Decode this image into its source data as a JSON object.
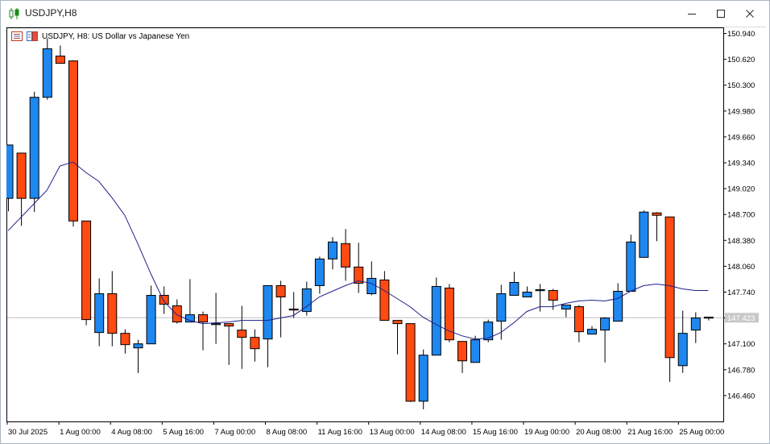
{
  "window": {
    "title": "USDJPY,H8",
    "icon": "candlestick-chart-icon",
    "controls": [
      "minimize-icon",
      "maximize-icon",
      "close-icon"
    ]
  },
  "chart_header": {
    "text": "USDJPY, H8:  US Dollar vs Japanese Yen",
    "icons": [
      "one-click-trading-icon",
      "market-depth-icon"
    ]
  },
  "colors": {
    "bull": "#1e88f0",
    "bear": "#ff4a12",
    "ma_line": "#1f1f8c",
    "grid_line": "#c0c0c0",
    "price_tag_bg": "#c8c8c8",
    "price_tag_text": "#ffffff"
  },
  "chart_data": {
    "type": "candlestick",
    "symbol": "USDJPY",
    "timeframe": "H8",
    "ylim": [
      146.2,
      151.06
    ],
    "y_ticks": [
      "150.940",
      "150.620",
      "150.300",
      "149.980",
      "149.660",
      "149.340",
      "149.020",
      "148.700",
      "148.380",
      "148.060",
      "147.740",
      "147.420",
      "147.100",
      "146.780",
      "146.460"
    ],
    "x_labels": [
      "30 Jul 2025",
      "1 Aug 00:00",
      "4 Aug 08:00",
      "5 Aug 16:00",
      "7 Aug 00:00",
      "8 Aug 08:00",
      "11 Aug 16:00",
      "13 Aug 00:00",
      "14 Aug 08:00",
      "15 Aug 16:00",
      "19 Aug 00:00",
      "20 Aug 08:00",
      "21 Aug 16:00",
      "25 Aug 00:00"
    ],
    "current_price": "147.423",
    "candles": [
      {
        "o": 148.9,
        "h": 149.51,
        "l": 148.74,
        "c": 149.56
      },
      {
        "o": 149.46,
        "h": 149.46,
        "l": 148.56,
        "c": 148.9
      },
      {
        "o": 148.9,
        "h": 150.22,
        "l": 148.73,
        "c": 150.15
      },
      {
        "o": 150.15,
        "h": 150.88,
        "l": 150.12,
        "c": 150.75
      },
      {
        "o": 150.66,
        "h": 150.79,
        "l": 150.64,
        "c": 150.57
      },
      {
        "o": 150.6,
        "h": 150.61,
        "l": 148.55,
        "c": 148.62
      },
      {
        "o": 148.62,
        "h": 148.62,
        "l": 147.33,
        "c": 147.4
      },
      {
        "o": 147.24,
        "h": 147.91,
        "l": 147.07,
        "c": 147.72
      },
      {
        "o": 147.72,
        "h": 148.0,
        "l": 147.07,
        "c": 147.23
      },
      {
        "o": 147.23,
        "h": 147.28,
        "l": 146.98,
        "c": 147.09
      },
      {
        "o": 147.05,
        "h": 147.15,
        "l": 146.74,
        "c": 147.1
      },
      {
        "o": 147.1,
        "h": 147.82,
        "l": 147.1,
        "c": 147.7
      },
      {
        "o": 147.7,
        "h": 147.81,
        "l": 147.47,
        "c": 147.59
      },
      {
        "o": 147.57,
        "h": 147.65,
        "l": 147.35,
        "c": 147.37
      },
      {
        "o": 147.37,
        "h": 147.9,
        "l": 147.37,
        "c": 147.46
      },
      {
        "o": 147.46,
        "h": 147.5,
        "l": 147.02,
        "c": 147.37
      },
      {
        "o": 147.35,
        "h": 147.73,
        "l": 147.1,
        "c": 147.35
      },
      {
        "o": 147.35,
        "h": 147.35,
        "l": 146.84,
        "c": 147.32
      },
      {
        "o": 147.27,
        "h": 147.57,
        "l": 146.79,
        "c": 147.18
      },
      {
        "o": 147.18,
        "h": 147.28,
        "l": 146.88,
        "c": 147.04
      },
      {
        "o": 147.16,
        "h": 147.4,
        "l": 146.81,
        "c": 147.82
      },
      {
        "o": 147.82,
        "h": 147.88,
        "l": 147.18,
        "c": 147.68
      },
      {
        "o": 147.53,
        "h": 147.74,
        "l": 147.42,
        "c": 147.52
      },
      {
        "o": 147.5,
        "h": 147.87,
        "l": 147.45,
        "c": 147.78
      },
      {
        "o": 147.82,
        "h": 148.18,
        "l": 147.72,
        "c": 148.15
      },
      {
        "o": 148.15,
        "h": 148.42,
        "l": 148.02,
        "c": 148.36
      },
      {
        "o": 148.34,
        "h": 148.52,
        "l": 147.88,
        "c": 148.05
      },
      {
        "o": 148.05,
        "h": 148.35,
        "l": 147.73,
        "c": 147.85
      },
      {
        "o": 147.72,
        "h": 148.12,
        "l": 147.7,
        "c": 147.91
      },
      {
        "o": 147.89,
        "h": 148.0,
        "l": 147.43,
        "c": 147.39
      },
      {
        "o": 147.39,
        "h": 147.35,
        "l": 146.97,
        "c": 147.35
      },
      {
        "o": 147.35,
        "h": 147.35,
        "l": 146.38,
        "c": 146.39
      },
      {
        "o": 146.39,
        "h": 147.03,
        "l": 146.29,
        "c": 146.96
      },
      {
        "o": 146.96,
        "h": 147.92,
        "l": 146.96,
        "c": 147.81
      },
      {
        "o": 147.79,
        "h": 147.84,
        "l": 147.12,
        "c": 147.15
      },
      {
        "o": 147.13,
        "h": 147.13,
        "l": 146.74,
        "c": 146.89
      },
      {
        "o": 146.87,
        "h": 147.2,
        "l": 146.87,
        "c": 147.15
      },
      {
        "o": 147.15,
        "h": 147.4,
        "l": 147.12,
        "c": 147.37
      },
      {
        "o": 147.38,
        "h": 147.83,
        "l": 147.15,
        "c": 147.72
      },
      {
        "o": 147.7,
        "h": 147.99,
        "l": 147.7,
        "c": 147.86
      },
      {
        "o": 147.68,
        "h": 147.81,
        "l": 147.68,
        "c": 147.74
      },
      {
        "o": 147.76,
        "h": 147.84,
        "l": 147.5,
        "c": 147.77
      },
      {
        "o": 147.76,
        "h": 147.78,
        "l": 147.52,
        "c": 147.64
      },
      {
        "o": 147.53,
        "h": 147.58,
        "l": 147.43,
        "c": 147.58
      },
      {
        "o": 147.56,
        "h": 147.58,
        "l": 147.12,
        "c": 147.25
      },
      {
        "o": 147.22,
        "h": 147.32,
        "l": 147.22,
        "c": 147.28
      },
      {
        "o": 147.27,
        "h": 147.43,
        "l": 146.87,
        "c": 147.42
      },
      {
        "o": 147.38,
        "h": 147.85,
        "l": 147.38,
        "c": 147.75
      },
      {
        "o": 147.75,
        "h": 148.45,
        "l": 147.75,
        "c": 148.36
      },
      {
        "o": 148.17,
        "h": 148.75,
        "l": 148.17,
        "c": 148.73
      },
      {
        "o": 148.72,
        "h": 148.73,
        "l": 148.37,
        "c": 148.69
      },
      {
        "o": 148.67,
        "h": 148.67,
        "l": 146.63,
        "c": 146.93
      },
      {
        "o": 146.83,
        "h": 147.51,
        "l": 146.74,
        "c": 147.23
      },
      {
        "o": 147.27,
        "h": 147.49,
        "l": 147.11,
        "c": 147.42
      },
      {
        "o": 147.42,
        "h": 147.43,
        "l": 147.39,
        "c": 147.43
      }
    ],
    "ma_line": [
      {
        "i": 0,
        "v": 148.5
      },
      {
        "i": 3,
        "v": 149.0
      },
      {
        "i": 4,
        "v": 149.3
      },
      {
        "i": 5,
        "v": 149.35
      },
      {
        "i": 6,
        "v": 149.22
      },
      {
        "i": 7,
        "v": 149.11
      },
      {
        "i": 8,
        "v": 148.91
      },
      {
        "i": 9,
        "v": 148.69
      },
      {
        "i": 10,
        "v": 148.34
      },
      {
        "i": 11,
        "v": 147.97
      },
      {
        "i": 12,
        "v": 147.63
      },
      {
        "i": 13,
        "v": 147.46
      },
      {
        "i": 14,
        "v": 147.39
      },
      {
        "i": 15,
        "v": 147.35
      },
      {
        "i": 16,
        "v": 147.36
      },
      {
        "i": 17,
        "v": 147.37
      },
      {
        "i": 18,
        "v": 147.39
      },
      {
        "i": 19,
        "v": 147.39
      },
      {
        "i": 20,
        "v": 147.39
      },
      {
        "i": 21,
        "v": 147.42
      },
      {
        "i": 22,
        "v": 147.45
      },
      {
        "i": 23,
        "v": 147.56
      },
      {
        "i": 24,
        "v": 147.68
      },
      {
        "i": 25,
        "v": 147.75
      },
      {
        "i": 26,
        "v": 147.82
      },
      {
        "i": 27,
        "v": 147.88
      },
      {
        "i": 28,
        "v": 147.85
      },
      {
        "i": 29,
        "v": 147.76
      },
      {
        "i": 30,
        "v": 147.66
      },
      {
        "i": 31,
        "v": 147.56
      },
      {
        "i": 32,
        "v": 147.43
      },
      {
        "i": 33,
        "v": 147.34
      },
      {
        "i": 34,
        "v": 147.26
      },
      {
        "i": 35,
        "v": 147.2
      },
      {
        "i": 36,
        "v": 147.16
      },
      {
        "i": 37,
        "v": 147.17
      },
      {
        "i": 38,
        "v": 147.24
      },
      {
        "i": 39,
        "v": 147.36
      },
      {
        "i": 40,
        "v": 147.5
      },
      {
        "i": 41,
        "v": 147.56
      },
      {
        "i": 42,
        "v": 147.56
      },
      {
        "i": 43,
        "v": 147.6
      },
      {
        "i": 44,
        "v": 147.63
      },
      {
        "i": 45,
        "v": 147.64
      },
      {
        "i": 46,
        "v": 147.63
      },
      {
        "i": 47,
        "v": 147.66
      },
      {
        "i": 48,
        "v": 147.75
      },
      {
        "i": 49,
        "v": 147.82
      },
      {
        "i": 50,
        "v": 147.84
      },
      {
        "i": 51,
        "v": 147.82
      },
      {
        "i": 52,
        "v": 147.78
      },
      {
        "i": 53,
        "v": 147.76
      },
      {
        "i": 54,
        "v": 147.76
      }
    ]
  }
}
